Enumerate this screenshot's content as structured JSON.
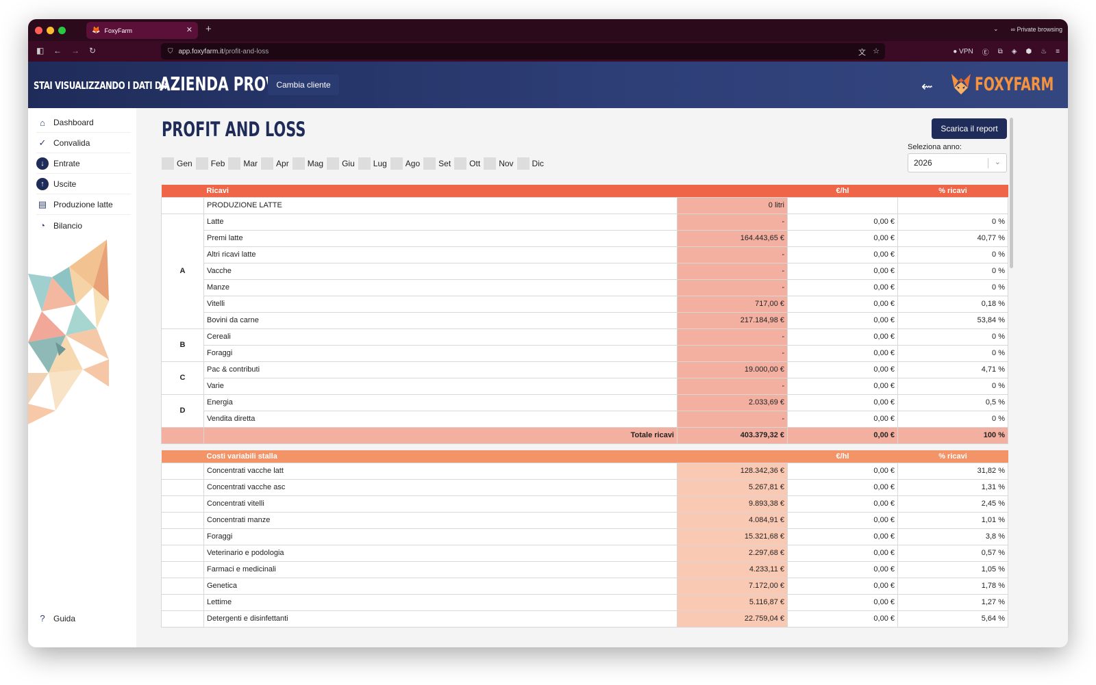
{
  "browser": {
    "tab_title": "FoxyFarm",
    "url_host": "app.foxyfarm.it",
    "url_path": "/profit-and-loss",
    "private_label": "Private browsing",
    "vpn_label": "VPN"
  },
  "header": {
    "viewing_label": "STAI VISUALIZZANDO I DATI DI:",
    "client_name": "AZIENDA PROVA",
    "switch_client": "Cambia cliente",
    "logo_text": "FOXYFARM"
  },
  "sidebar": {
    "items": [
      {
        "label": "Dashboard",
        "icon": "home-icon"
      },
      {
        "label": "Convalida",
        "icon": "check-icon"
      },
      {
        "label": "Entrate",
        "icon": "arrow-down-circle-icon"
      },
      {
        "label": "Uscite",
        "icon": "arrow-up-circle-icon"
      },
      {
        "label": "Produzione latte",
        "icon": "milk-carton-icon"
      },
      {
        "label": "Bilancio",
        "icon": "pie-chart-icon"
      }
    ],
    "help": {
      "label": "Guida",
      "icon": "question-icon"
    }
  },
  "page": {
    "title": "PROFIT AND LOSS",
    "download": "Scarica il report",
    "year_label": "Seleziona anno:",
    "year_value": "2026",
    "months": [
      "Gen",
      "Feb",
      "Mar",
      "Apr",
      "Mag",
      "Giu",
      "Lug",
      "Ago",
      "Set",
      "Ott",
      "Nov",
      "Dic"
    ]
  },
  "revenue": {
    "header": {
      "title": "Ricavi",
      "col_eur_hl": "€/hl",
      "col_pct": "% ricavi"
    },
    "production": {
      "label": "PRODUZIONE LATTE",
      "value": "0 litri"
    },
    "rows": [
      {
        "group": "A",
        "label": "Latte",
        "amount": "-",
        "eur_hl": "0,00 €",
        "pct": "0 %"
      },
      {
        "group": "",
        "label": "Premi latte",
        "amount": "164.443,65 €",
        "eur_hl": "0,00 €",
        "pct": "40,77 %"
      },
      {
        "group": "",
        "label": "Altri ricavi latte",
        "amount": "-",
        "eur_hl": "0,00 €",
        "pct": "0 %"
      },
      {
        "group": "",
        "label": "Vacche",
        "amount": "-",
        "eur_hl": "0,00 €",
        "pct": "0 %"
      },
      {
        "group": "",
        "label": "Manze",
        "amount": "-",
        "eur_hl": "0,00 €",
        "pct": "0 %"
      },
      {
        "group": "",
        "label": "Vitelli",
        "amount": "717,00 €",
        "eur_hl": "0,00 €",
        "pct": "0,18 %"
      },
      {
        "group": "",
        "label": "Bovini da carne",
        "amount": "217.184,98 €",
        "eur_hl": "0,00 €",
        "pct": "53,84 %"
      },
      {
        "group": "B",
        "label": "Cereali",
        "amount": "-",
        "eur_hl": "0,00 €",
        "pct": "0 %"
      },
      {
        "group": "",
        "label": "Foraggi",
        "amount": "-",
        "eur_hl": "0,00 €",
        "pct": "0 %"
      },
      {
        "group": "C",
        "label": "Pac & contributi",
        "amount": "19.000,00 €",
        "eur_hl": "0,00 €",
        "pct": "4,71 %"
      },
      {
        "group": "",
        "label": "Varie",
        "amount": "-",
        "eur_hl": "0,00 €",
        "pct": "0 %"
      },
      {
        "group": "D",
        "label": "Energia",
        "amount": "2.033,69 €",
        "eur_hl": "0,00 €",
        "pct": "0,5 %"
      },
      {
        "group": "",
        "label": "Vendita diretta",
        "amount": "-",
        "eur_hl": "0,00 €",
        "pct": "0 %"
      }
    ],
    "group_spans": {
      "A": 7,
      "B": 2,
      "C": 2,
      "D": 2
    },
    "total": {
      "label": "Totale ricavi",
      "amount": "403.379,32 €",
      "eur_hl": "0,00 €",
      "pct": "100 %"
    }
  },
  "variable_costs": {
    "header": {
      "title": "Costi variabili stalla",
      "col_eur_hl": "€/hl",
      "col_pct": "% ricavi"
    },
    "rows": [
      {
        "label": "Concentrati vacche latt",
        "amount": "128.342,36 €",
        "eur_hl": "0,00 €",
        "pct": "31,82 %"
      },
      {
        "label": "Concentrati vacche asc",
        "amount": "5.267,81 €",
        "eur_hl": "0,00 €",
        "pct": "1,31 %"
      },
      {
        "label": "Concentrati vitelli",
        "amount": "9.893,38 €",
        "eur_hl": "0,00 €",
        "pct": "2,45 %"
      },
      {
        "label": "Concentrati manze",
        "amount": "4.084,91 €",
        "eur_hl": "0,00 €",
        "pct": "1,01 %"
      },
      {
        "label": "Foraggi",
        "amount": "15.321,68 €",
        "eur_hl": "0,00 €",
        "pct": "3,8 %"
      },
      {
        "label": "Veterinario e podologia",
        "amount": "2.297,68 €",
        "eur_hl": "0,00 €",
        "pct": "0,57 %"
      },
      {
        "label": "Farmaci e medicinali",
        "amount": "4.233,11 €",
        "eur_hl": "0,00 €",
        "pct": "1,05 %"
      },
      {
        "label": "Genetica",
        "amount": "7.172,00 €",
        "eur_hl": "0,00 €",
        "pct": "1,78 %"
      },
      {
        "label": "Lettime",
        "amount": "5.116,87 €",
        "eur_hl": "0,00 €",
        "pct": "1,27 %"
      },
      {
        "label": "Detergenti e disinfettanti",
        "amount": "22.759,04 €",
        "eur_hl": "0,00 €",
        "pct": "5,64 %"
      }
    ]
  },
  "colors": {
    "brand_navy": "#1f2c5a",
    "revenue_header": "#ee6548",
    "revenue_amount": "#f3b0a1",
    "cost_header": "#f39368",
    "cost_amount": "#f9c9b4",
    "logo_orange": "#f3923f"
  }
}
